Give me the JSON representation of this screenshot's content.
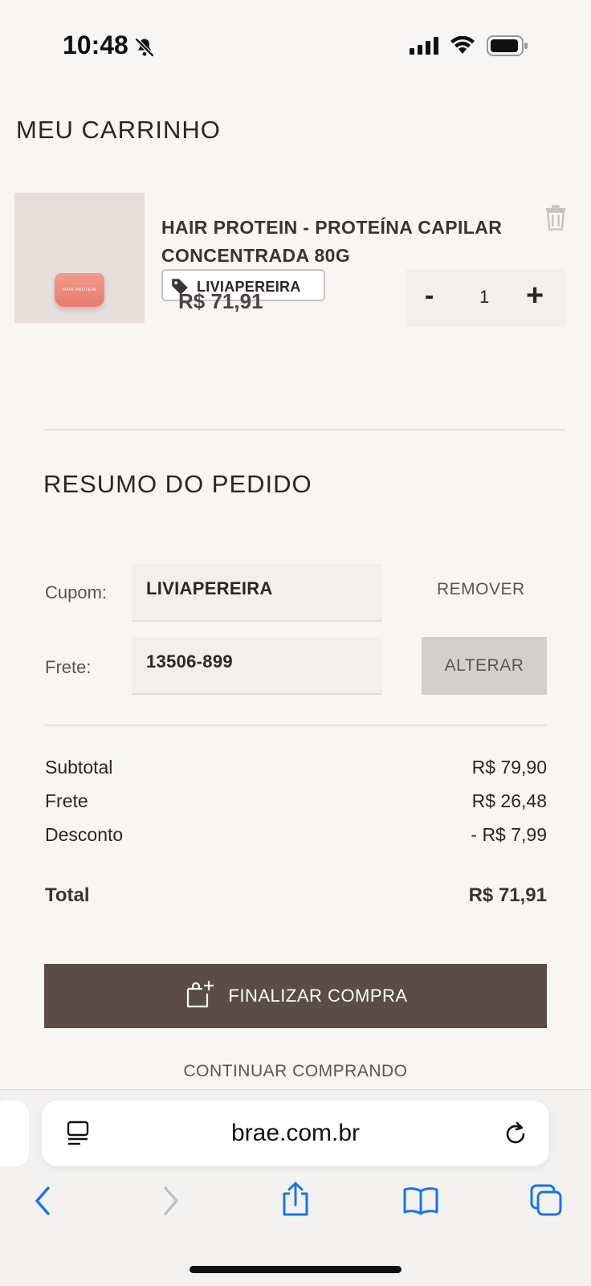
{
  "status": {
    "time": "10:48"
  },
  "page": {
    "title": "MEU CARRINHO"
  },
  "item": {
    "name": "HAIR PROTEIN - PROTEÍNA CAPILAR CONCENTRADA 80G",
    "coupon_tag": "LIVIAPEREIRA",
    "price": "R$ 71,91",
    "quantity": "1",
    "minus_label": "-",
    "plus_label": "+"
  },
  "summary": {
    "title": "RESUMO DO PEDIDO",
    "coupon_label": "Cupom:",
    "coupon_value": "LIVIAPEREIRA",
    "remove_label": "REMOVER",
    "shipping_label": "Frete:",
    "shipping_value": "13506-899",
    "change_label": "ALTERAR",
    "rows": [
      {
        "label": "Subtotal",
        "value": "R$ 79,90"
      },
      {
        "label": "Frete",
        "value": "R$ 26,48"
      },
      {
        "label": "Desconto",
        "value": "- R$ 7,99"
      }
    ],
    "total_label": "Total",
    "total_value": "R$ 71,91",
    "checkout_label": "FINALIZAR COMPRA",
    "continue_label": "CONTINUAR COMPRANDO"
  },
  "browser": {
    "url": "brae.com.br"
  },
  "colors": {
    "brand_dark": "#5b4c49",
    "ios_blue": "#1a73e8"
  }
}
